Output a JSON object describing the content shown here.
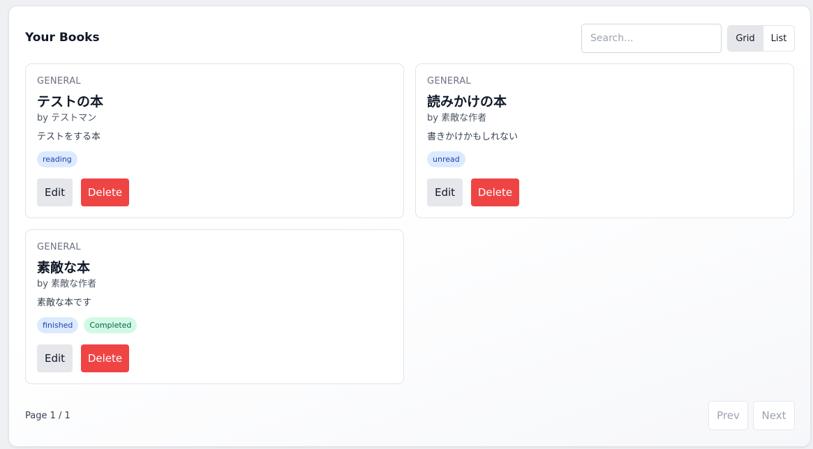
{
  "header": {
    "title": "Your Books",
    "search_placeholder": "Search...",
    "view_grid_label": "Grid",
    "view_list_label": "List",
    "active_view": "Grid"
  },
  "books": [
    {
      "category": "GENERAL",
      "title": "テストの本",
      "author": "by テストマン",
      "description": "テストをする本",
      "tags": [
        "reading"
      ],
      "edit_label": "Edit",
      "delete_label": "Delete"
    },
    {
      "category": "GENERAL",
      "title": "読みかけの本",
      "author": "by 素敵な作者",
      "description": "書きかけかもしれない",
      "tags": [
        "unread"
      ],
      "edit_label": "Edit",
      "delete_label": "Delete"
    },
    {
      "category": "GENERAL",
      "title": "素敵な本",
      "author": "by 素敵な作者",
      "description": "素敵な本です",
      "tags": [
        "finished",
        "Completed"
      ],
      "edit_label": "Edit",
      "delete_label": "Delete"
    }
  ],
  "pagination": {
    "page_text": "Page 1 / 1",
    "prev_label": "Prev",
    "next_label": "Next"
  },
  "colors": {
    "delete": "#ef4444",
    "edit": "#e5e7eb",
    "tag_status_bg": "#dbeafe",
    "tag_completed_bg": "#d1fae5"
  }
}
